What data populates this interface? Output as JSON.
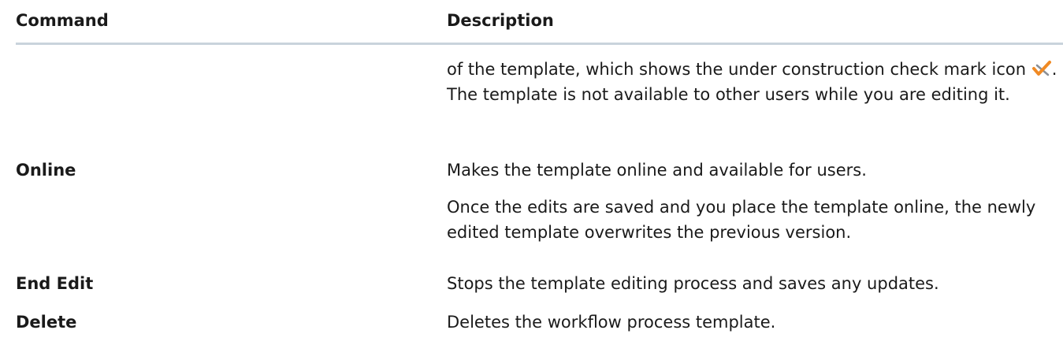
{
  "header": {
    "command": "Command",
    "description": "Description"
  },
  "rows": [
    {
      "command": "",
      "description": {
        "before_icon": "of the template, which shows the under construction check mark icon ",
        "after_icon": ". The template is not available to other users while you are editing it."
      }
    },
    {
      "command": "Online",
      "paragraphs": [
        "Makes the template online and available for users.",
        "Once the edits are saved and you place the template online, the newly edited template overwrites the previous version."
      ]
    },
    {
      "command": "End Edit",
      "paragraphs": [
        "Stops the template editing process and saves any updates."
      ]
    },
    {
      "command": "Delete",
      "paragraphs": [
        "Deletes the workflow process template."
      ]
    }
  ],
  "colors": {
    "header_rule": "#c9d3dc",
    "check_orange": "#f08a24",
    "cross_gray": "#8a8f96"
  },
  "icons": {
    "under_construction": "under-construction-check-icon"
  }
}
